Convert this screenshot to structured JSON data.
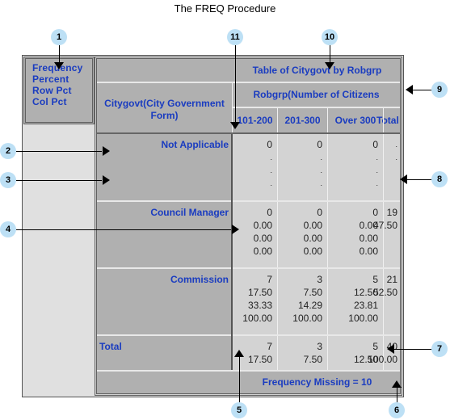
{
  "title": "The FREQ Procedure",
  "legend": [
    "Frequency",
    "Percent",
    "Row Pct",
    "Col Pct"
  ],
  "table": {
    "title": "Table of Citygovt by Robgrp",
    "column_variable": "Robgrp(Number of Citizens Robbed)",
    "row_variable": "Citygovt(City Government Form)",
    "columns": [
      "101-200",
      "201-300",
      "Over 300",
      "Total"
    ],
    "rows": [
      {
        "label": "Not Applicable",
        "cells": [
          [
            "0",
            ".",
            ".",
            "."
          ],
          [
            "0",
            ".",
            ".",
            "."
          ],
          [
            "0",
            ".",
            ".",
            "."
          ],
          [
            ".",
            "."
          ]
        ]
      },
      {
        "label": "Council Manager",
        "cells": [
          [
            "0",
            "0.00",
            "0.00",
            "0.00"
          ],
          [
            "0",
            "0.00",
            "0.00",
            "0.00"
          ],
          [
            "0",
            "0.00",
            "0.00",
            "0.00"
          ],
          [
            "19",
            "47.50"
          ]
        ]
      },
      {
        "label": "Commission",
        "cells": [
          [
            "7",
            "17.50",
            "33.33",
            "100.00"
          ],
          [
            "3",
            "7.50",
            "14.29",
            "100.00"
          ],
          [
            "5",
            "12.50",
            "23.81",
            "100.00"
          ],
          [
            "21",
            "52.50"
          ]
        ]
      },
      {
        "label": "Total",
        "cells": [
          [
            "7",
            "17.50"
          ],
          [
            "3",
            "7.50"
          ],
          [
            "5",
            "12.50"
          ],
          [
            "40",
            "100.00"
          ]
        ]
      }
    ],
    "frequency_missing": "Frequency Missing = 10"
  },
  "callouts": [
    "1",
    "2",
    "3",
    "4",
    "5",
    "6",
    "7",
    "8",
    "9",
    "10",
    "11"
  ],
  "colors": {
    "header_bg": "#b0b0b0",
    "data_bg": "#d3d3d3",
    "label_text": "#1a3cc0",
    "callout_bg": "#bde0f5"
  }
}
